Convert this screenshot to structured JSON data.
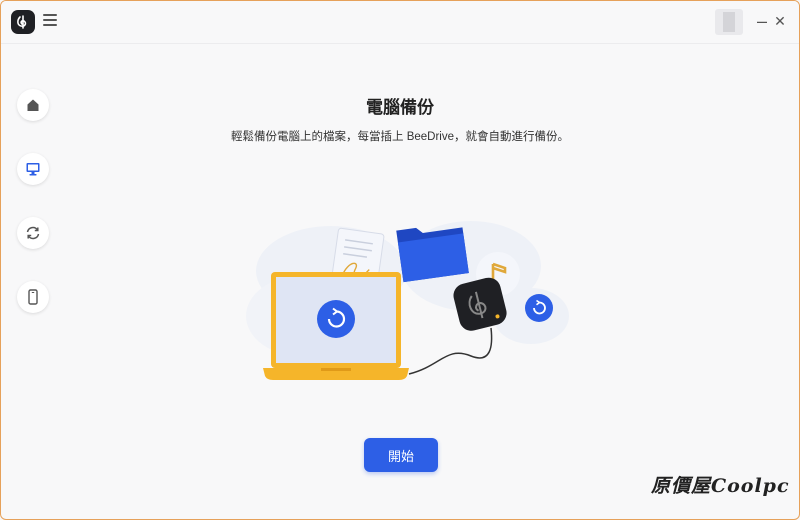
{
  "header": {
    "logo_icon": "beedrive-logo-icon",
    "menu_icon": "hamburger-menu-icon",
    "minimize_label": "–",
    "close_label": "✕"
  },
  "sidebar": {
    "items": [
      {
        "icon": "home-icon",
        "active": false
      },
      {
        "icon": "computer-icon",
        "active": true
      },
      {
        "icon": "sync-icon",
        "active": false
      },
      {
        "icon": "phone-icon",
        "active": false
      }
    ]
  },
  "main": {
    "title": "電腦備份",
    "description": "輕鬆備份電腦上的檔案，每當插上 BeeDrive，就會自動進行備份。",
    "start_button_label": "開始"
  },
  "watermark": "原價屋Coolpc",
  "colors": {
    "accent": "#2d5fe6",
    "laptop": "#f5b52a",
    "folder": "#2a55d6",
    "window_border": "#e6a15a"
  }
}
